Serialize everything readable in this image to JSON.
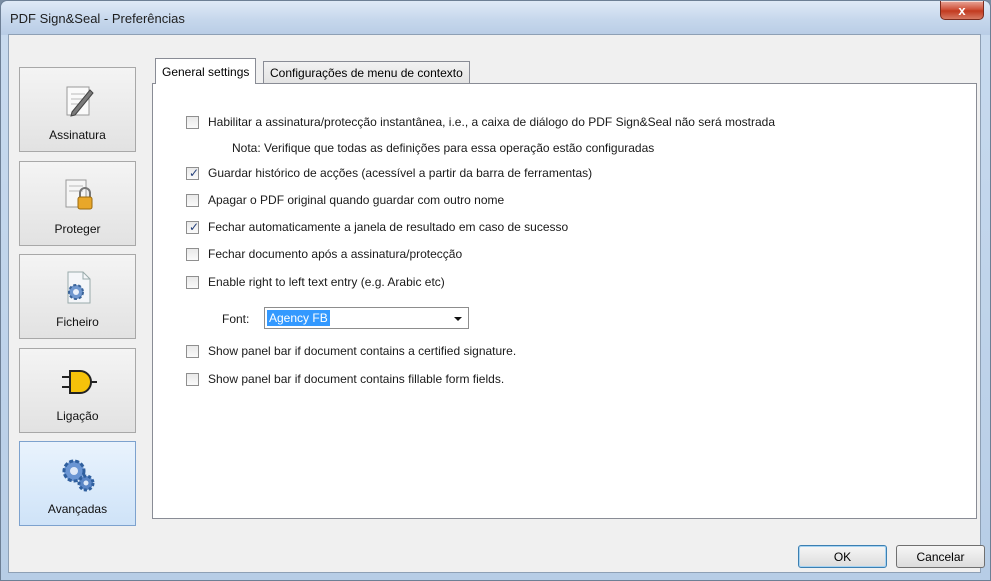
{
  "window": {
    "title": "PDF Sign&Seal - Preferências",
    "close_label": "x"
  },
  "sidebar": {
    "items": [
      {
        "label": "Assinatura",
        "icon": "pen-paper-icon",
        "active": false
      },
      {
        "label": "Proteger",
        "icon": "lock-document-icon",
        "active": false
      },
      {
        "label": "Ficheiro",
        "icon": "gear-document-icon",
        "active": false
      },
      {
        "label": "Ligação",
        "icon": "plug-icon",
        "active": false
      },
      {
        "label": "Avançadas",
        "icon": "gears-icon",
        "active": true
      }
    ]
  },
  "tabs": [
    {
      "label": "General settings",
      "active": true
    },
    {
      "label": "Configurações de menu de contexto",
      "active": false
    }
  ],
  "options": [
    {
      "label": "Habilitar a assinatura/protecção instantânea, i.e., a caixa de diálogo do PDF Sign&Seal não será mostrada",
      "checked": false
    },
    {
      "label": "Guardar histórico de acções (acessível a partir da barra de ferramentas)",
      "checked": true
    },
    {
      "label": "Apagar o PDF original quando guardar com outro nome",
      "checked": false
    },
    {
      "label": "Fechar automaticamente a janela de resultado em caso de sucesso",
      "checked": true
    },
    {
      "label": "Fechar documento após a assinatura/protecção",
      "checked": false
    },
    {
      "label": "Enable right to left text entry (e.g. Arabic etc)",
      "checked": false
    },
    {
      "label": "Show panel bar if document contains a certified signature.",
      "checked": false
    },
    {
      "label": "Show panel bar if document contains fillable form fields.",
      "checked": false
    }
  ],
  "note": "Nota: Verifique que todas as definições para essa operação estão configuradas",
  "font": {
    "label": "Font:",
    "value": "Agency FB"
  },
  "buttons": {
    "ok": "OK",
    "cancel": "Cancelar"
  },
  "colors": {
    "selection": "#3399ff",
    "active_sidebar": "#cfe3f8"
  }
}
